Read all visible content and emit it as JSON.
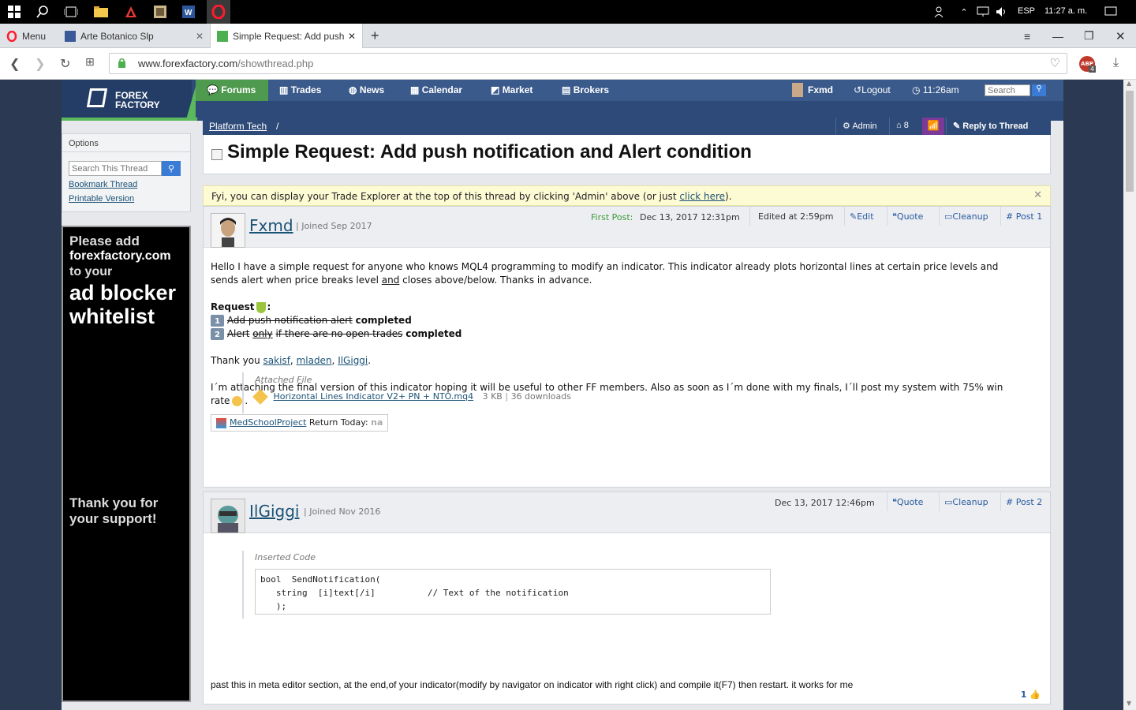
{
  "taskbar": {
    "lang": "ESP",
    "clock": "11:27 a. m."
  },
  "tabs": [
    {
      "label": "Menu"
    },
    {
      "label": "Arte Botanico Slp"
    },
    {
      "label": "Simple Request: Add push"
    }
  ],
  "address": {
    "url_domain": "www.forexfactory.com",
    "url_path": "/showthread.php",
    "abp_count": "4"
  },
  "ff": {
    "logo_line1": "FOREX",
    "logo_line2": "FACTORY",
    "nav": [
      "Forums",
      "Trades",
      "News",
      "Calendar",
      "Market",
      "Brokers"
    ],
    "user": "Fxmd",
    "logout": "Logout",
    "time": "11:26am",
    "search_placeholder": "Search"
  },
  "options": {
    "title": "Options",
    "search_placeholder": "Search This Thread",
    "bookmark": "Bookmark Thread",
    "printable": "Printable Version"
  },
  "ad": {
    "line1": "Please add",
    "line2": "forexfactory.com",
    "line3": "to your",
    "line4": "ad blocker",
    "line5": "whitelist",
    "thanks1": "Thank you for",
    "thanks2": "your support!"
  },
  "crumb": {
    "forum": "Platform Tech",
    "sep": "/",
    "admin": "Admin",
    "count": "8",
    "reply": "Reply to Thread"
  },
  "thread": {
    "title": "Simple Request: Add push notification and Alert condition"
  },
  "fyi": {
    "text": "Fyi, you can display your Trade Explorer at the top of this thread by clicking 'Admin' above (or just",
    "link": "click here",
    "end": ")."
  },
  "post1": {
    "user": "Fxmd",
    "joined": "| Joined Sep 2017",
    "first_post_label": "First Post:",
    "date": "Dec 13, 2017 12:31pm",
    "edited": "Edited at 2:59pm",
    "actions": [
      "Edit",
      "Quote",
      "Cleanup",
      "Post 1"
    ],
    "p1": "Hello I have a simple request for anyone who knows MQL4 programming to modify an indicator. This indicator already plots horizontal lines at certain price levels and",
    "p1b_pre": "sends alert when price breaks level",
    "p1b_and": "and",
    "p1b_post": "closes above/below. Thanks in advance.",
    "request_label": "Request",
    "item1_strike": "Add push notification alert",
    "item1_done": "completed",
    "item2_strike_a": "Alert",
    "item2_only": "only",
    "item2_strike_b": "if there are no open trades",
    "item2_done": "completed",
    "thanks": "Thank you",
    "thanks_users": [
      "sakisf",
      "mladen",
      "IlGiggi"
    ],
    "p3": "I´m attaching the final version of this indicator hoping it will be useful to other FF members. Also as soon as I´m done with my finals, I´ll post my system with 75% win",
    "p3b": "rate",
    "attached_label": "Attached File",
    "file_name": "Horizontal Lines Indicator V2+ PN + NTO.mq4",
    "file_size": "3 KB",
    "file_downloads": "36 downloads",
    "sig_link": "MedSchoolProject",
    "sig_text": "Return Today:",
    "sig_val": "na"
  },
  "post2": {
    "user": "IlGiggi",
    "joined": "| Joined Nov 2016",
    "date": "Dec 13, 2017 12:46pm",
    "actions": [
      "Quote",
      "Cleanup",
      "Post 2"
    ],
    "code_label": "Inserted Code",
    "code": "bool  SendNotification(\n   string  [i]text[/i]          // Text of the notification\n   );",
    "text": "past this in meta editor section, at the end,of your indicator(modify by navigator on indicator with right click) and compile it(F7) then restart. it works for me",
    "likes": "1"
  }
}
